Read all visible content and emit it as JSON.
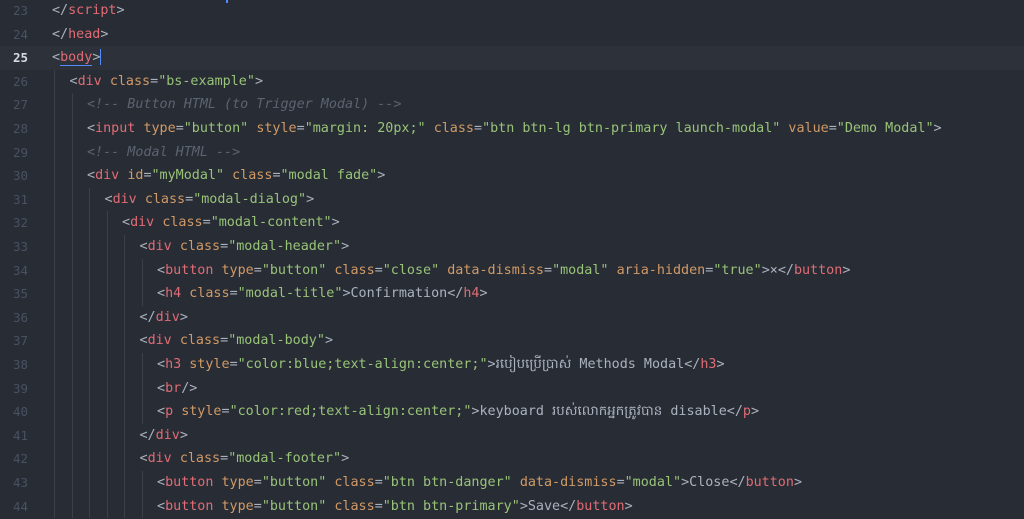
{
  "editor": {
    "active_line": 25,
    "lines": [
      {
        "n": "23",
        "indent": 0,
        "tokens": [
          [
            "punc",
            "</"
          ],
          [
            "tag",
            "script"
          ],
          [
            "punc",
            ">"
          ]
        ]
      },
      {
        "n": "24",
        "indent": 0,
        "tokens": [
          [
            "punc",
            "</"
          ],
          [
            "tag",
            "head"
          ],
          [
            "punc",
            ">"
          ]
        ]
      },
      {
        "n": "25",
        "indent": 0,
        "tokens": [
          [
            "punc",
            "<"
          ],
          [
            "tag",
            "body"
          ],
          [
            "punc",
            ">"
          ]
        ]
      },
      {
        "n": "26",
        "indent": 1,
        "tokens": [
          [
            "punc",
            "<"
          ],
          [
            "tag",
            "div"
          ],
          [
            "txt",
            " "
          ],
          [
            "attr",
            "class"
          ],
          [
            "punc",
            "="
          ],
          [
            "str",
            "\"bs-example\""
          ],
          [
            "punc",
            ">"
          ]
        ]
      },
      {
        "n": "27",
        "indent": 2,
        "tokens": [
          [
            "cmt",
            "<!-- Button HTML (to Trigger Modal) -->"
          ]
        ]
      },
      {
        "n": "28",
        "indent": 2,
        "tokens": [
          [
            "punc",
            "<"
          ],
          [
            "tag",
            "input"
          ],
          [
            "txt",
            " "
          ],
          [
            "attr",
            "type"
          ],
          [
            "punc",
            "="
          ],
          [
            "str",
            "\"button\""
          ],
          [
            "txt",
            " "
          ],
          [
            "attr",
            "style"
          ],
          [
            "punc",
            "="
          ],
          [
            "str",
            "\"margin: 20px;\""
          ],
          [
            "txt",
            " "
          ],
          [
            "attr",
            "class"
          ],
          [
            "punc",
            "="
          ],
          [
            "str",
            "\"btn btn-lg btn-primary launch-modal\""
          ],
          [
            "txt",
            " "
          ],
          [
            "attr",
            "value"
          ],
          [
            "punc",
            "="
          ],
          [
            "str",
            "\"Demo Modal\""
          ],
          [
            "punc",
            ">"
          ]
        ]
      },
      {
        "n": "29",
        "indent": 2,
        "tokens": [
          [
            "cmt",
            "<!-- Modal HTML -->"
          ]
        ]
      },
      {
        "n": "30",
        "indent": 2,
        "tokens": [
          [
            "punc",
            "<"
          ],
          [
            "tag",
            "div"
          ],
          [
            "txt",
            " "
          ],
          [
            "attr",
            "id"
          ],
          [
            "punc",
            "="
          ],
          [
            "str",
            "\"myModal\""
          ],
          [
            "txt",
            " "
          ],
          [
            "attr",
            "class"
          ],
          [
            "punc",
            "="
          ],
          [
            "str",
            "\"modal fade\""
          ],
          [
            "punc",
            ">"
          ]
        ]
      },
      {
        "n": "31",
        "indent": 3,
        "tokens": [
          [
            "punc",
            "<"
          ],
          [
            "tag",
            "div"
          ],
          [
            "txt",
            " "
          ],
          [
            "attr",
            "class"
          ],
          [
            "punc",
            "="
          ],
          [
            "str",
            "\"modal-dialog\""
          ],
          [
            "punc",
            ">"
          ]
        ]
      },
      {
        "n": "32",
        "indent": 4,
        "tokens": [
          [
            "punc",
            "<"
          ],
          [
            "tag",
            "div"
          ],
          [
            "txt",
            " "
          ],
          [
            "attr",
            "class"
          ],
          [
            "punc",
            "="
          ],
          [
            "str",
            "\"modal-content\""
          ],
          [
            "punc",
            ">"
          ]
        ]
      },
      {
        "n": "33",
        "indent": 5,
        "tokens": [
          [
            "punc",
            "<"
          ],
          [
            "tag",
            "div"
          ],
          [
            "txt",
            " "
          ],
          [
            "attr",
            "class"
          ],
          [
            "punc",
            "="
          ],
          [
            "str",
            "\"modal-header\""
          ],
          [
            "punc",
            ">"
          ]
        ]
      },
      {
        "n": "34",
        "indent": 6,
        "tokens": [
          [
            "punc",
            "<"
          ],
          [
            "tag",
            "button"
          ],
          [
            "txt",
            " "
          ],
          [
            "attr",
            "type"
          ],
          [
            "punc",
            "="
          ],
          [
            "str",
            "\"button\""
          ],
          [
            "txt",
            " "
          ],
          [
            "attr",
            "class"
          ],
          [
            "punc",
            "="
          ],
          [
            "str",
            "\"close\""
          ],
          [
            "txt",
            " "
          ],
          [
            "attr",
            "data-dismiss"
          ],
          [
            "punc",
            "="
          ],
          [
            "str",
            "\"modal\""
          ],
          [
            "txt",
            " "
          ],
          [
            "attr",
            "aria-hidden"
          ],
          [
            "punc",
            "="
          ],
          [
            "str",
            "\"true\""
          ],
          [
            "punc",
            ">"
          ],
          [
            "txt",
            "×"
          ],
          [
            "punc",
            "</"
          ],
          [
            "tag",
            "button"
          ],
          [
            "punc",
            ">"
          ]
        ]
      },
      {
        "n": "35",
        "indent": 6,
        "tokens": [
          [
            "punc",
            "<"
          ],
          [
            "tag",
            "h4"
          ],
          [
            "txt",
            " "
          ],
          [
            "attr",
            "class"
          ],
          [
            "punc",
            "="
          ],
          [
            "str",
            "\"modal-title\""
          ],
          [
            "punc",
            ">"
          ],
          [
            "txt",
            "Confirmation"
          ],
          [
            "punc",
            "</"
          ],
          [
            "tag",
            "h4"
          ],
          [
            "punc",
            ">"
          ]
        ]
      },
      {
        "n": "36",
        "indent": 5,
        "tokens": [
          [
            "punc",
            "</"
          ],
          [
            "tag",
            "div"
          ],
          [
            "punc",
            ">"
          ]
        ]
      },
      {
        "n": "37",
        "indent": 5,
        "tokens": [
          [
            "punc",
            "<"
          ],
          [
            "tag",
            "div"
          ],
          [
            "txt",
            " "
          ],
          [
            "attr",
            "class"
          ],
          [
            "punc",
            "="
          ],
          [
            "str",
            "\"modal-body\""
          ],
          [
            "punc",
            ">"
          ]
        ]
      },
      {
        "n": "38",
        "indent": 6,
        "tokens": [
          [
            "punc",
            "<"
          ],
          [
            "tag",
            "h3"
          ],
          [
            "txt",
            " "
          ],
          [
            "attr",
            "style"
          ],
          [
            "punc",
            "="
          ],
          [
            "str",
            "\"color:blue;text-align:center;\""
          ],
          [
            "punc",
            ">"
          ],
          [
            "txt",
            "របៀបប្រើប្រាស់ Methods Modal"
          ],
          [
            "punc",
            "</"
          ],
          [
            "tag",
            "h3"
          ],
          [
            "punc",
            ">"
          ]
        ]
      },
      {
        "n": "39",
        "indent": 6,
        "tokens": [
          [
            "punc",
            "<"
          ],
          [
            "tag",
            "br"
          ],
          [
            "punc",
            "/>"
          ]
        ]
      },
      {
        "n": "40",
        "indent": 6,
        "tokens": [
          [
            "punc",
            "<"
          ],
          [
            "tag",
            "p"
          ],
          [
            "txt",
            " "
          ],
          [
            "attr",
            "style"
          ],
          [
            "punc",
            "="
          ],
          [
            "str",
            "\"color:red;text-align:center;\""
          ],
          [
            "punc",
            ">"
          ],
          [
            "txt",
            "keyboard របស់លោកអ្នកត្រូវបាន disable"
          ],
          [
            "punc",
            "</"
          ],
          [
            "tag",
            "p"
          ],
          [
            "punc",
            ">"
          ]
        ]
      },
      {
        "n": "41",
        "indent": 5,
        "tokens": [
          [
            "punc",
            "</"
          ],
          [
            "tag",
            "div"
          ],
          [
            "punc",
            ">"
          ]
        ]
      },
      {
        "n": "42",
        "indent": 5,
        "tokens": [
          [
            "punc",
            "<"
          ],
          [
            "tag",
            "div"
          ],
          [
            "txt",
            " "
          ],
          [
            "attr",
            "class"
          ],
          [
            "punc",
            "="
          ],
          [
            "str",
            "\"modal-footer\""
          ],
          [
            "punc",
            ">"
          ]
        ]
      },
      {
        "n": "43",
        "indent": 6,
        "tokens": [
          [
            "punc",
            "<"
          ],
          [
            "tag",
            "button"
          ],
          [
            "txt",
            " "
          ],
          [
            "attr",
            "type"
          ],
          [
            "punc",
            "="
          ],
          [
            "str",
            "\"button\""
          ],
          [
            "txt",
            " "
          ],
          [
            "attr",
            "class"
          ],
          [
            "punc",
            "="
          ],
          [
            "str",
            "\"btn btn-danger\""
          ],
          [
            "txt",
            " "
          ],
          [
            "attr",
            "data-dismiss"
          ],
          [
            "punc",
            "="
          ],
          [
            "str",
            "\"modal\""
          ],
          [
            "punc",
            ">"
          ],
          [
            "txt",
            "Close"
          ],
          [
            "punc",
            "</"
          ],
          [
            "tag",
            "button"
          ],
          [
            "punc",
            ">"
          ]
        ]
      },
      {
        "n": "44",
        "indent": 6,
        "tokens": [
          [
            "punc",
            "<"
          ],
          [
            "tag",
            "button"
          ],
          [
            "txt",
            " "
          ],
          [
            "attr",
            "type"
          ],
          [
            "punc",
            "="
          ],
          [
            "str",
            "\"button\""
          ],
          [
            "txt",
            " "
          ],
          [
            "attr",
            "class"
          ],
          [
            "punc",
            "="
          ],
          [
            "str",
            "\"btn btn-primary\""
          ],
          [
            "punc",
            ">"
          ],
          [
            "txt",
            "Save"
          ],
          [
            "punc",
            "</"
          ],
          [
            "tag",
            "button"
          ],
          [
            "punc",
            ">"
          ]
        ]
      }
    ]
  }
}
